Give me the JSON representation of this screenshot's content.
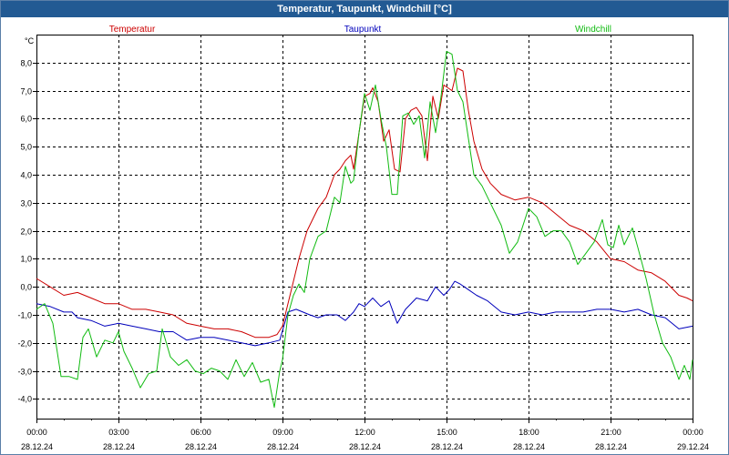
{
  "window": {
    "title": "Temperatur, Taupunkt, Windchill [°C]"
  },
  "colors": {
    "temperatur": "#cc0000",
    "taupunkt": "#0000bb",
    "windchill": "#11bb11",
    "title_bar": "#225a93"
  },
  "chart_data": {
    "type": "line",
    "title": "Temperatur, Taupunkt, Windchill [°C]",
    "ylabel": "°C",
    "xlabel": "",
    "ylim": [
      -4.7,
      9.0
    ],
    "xlim": [
      0,
      24
    ],
    "grid": true,
    "legend_placement": "top",
    "y_ticks": [
      {
        "value": 8,
        "label": "8,0"
      },
      {
        "value": 7,
        "label": "7,0"
      },
      {
        "value": 6,
        "label": "6,0"
      },
      {
        "value": 5,
        "label": "5,0"
      },
      {
        "value": 4,
        "label": "4,0"
      },
      {
        "value": 3,
        "label": "3,0"
      },
      {
        "value": 2,
        "label": "2,0"
      },
      {
        "value": 1,
        "label": "1,0"
      },
      {
        "value": 0,
        "label": "0,0"
      },
      {
        "value": -1,
        "label": "-1,0"
      },
      {
        "value": -2,
        "label": "-2,0"
      },
      {
        "value": -3,
        "label": "-3,0"
      },
      {
        "value": -4,
        "label": "-4,0"
      }
    ],
    "x_ticks": [
      {
        "value": 0,
        "time": "00:00",
        "date": "28.12.24"
      },
      {
        "value": 3,
        "time": "03:00",
        "date": "28.12.24"
      },
      {
        "value": 6,
        "time": "06:00",
        "date": "28.12.24"
      },
      {
        "value": 9,
        "time": "09:00",
        "date": "28.12.24"
      },
      {
        "value": 12,
        "time": "12:00",
        "date": "28.12.24"
      },
      {
        "value": 15,
        "time": "15:00",
        "date": "28.12.24"
      },
      {
        "value": 18,
        "time": "18:00",
        "date": "28.12.24"
      },
      {
        "value": 21,
        "time": "21:00",
        "date": "28.12.24"
      },
      {
        "value": 24,
        "time": "00:00",
        "date": "29.12.24"
      }
    ],
    "series": [
      {
        "name": "Temperatur",
        "points": [
          [
            0,
            0.3
          ],
          [
            0.5,
            0.0
          ],
          [
            1,
            -0.3
          ],
          [
            1.5,
            -0.2
          ],
          [
            2,
            -0.4
          ],
          [
            2.5,
            -0.6
          ],
          [
            3,
            -0.6
          ],
          [
            3.5,
            -0.8
          ],
          [
            4,
            -0.8
          ],
          [
            4.5,
            -0.9
          ],
          [
            5,
            -1.0
          ],
          [
            5.5,
            -1.3
          ],
          [
            6,
            -1.4
          ],
          [
            6.5,
            -1.5
          ],
          [
            7,
            -1.5
          ],
          [
            7.5,
            -1.6
          ],
          [
            8,
            -1.8
          ],
          [
            8.5,
            -1.8
          ],
          [
            8.8,
            -1.7
          ],
          [
            9,
            -1.4
          ],
          [
            9.2,
            -0.6
          ],
          [
            9.4,
            0.2
          ],
          [
            9.6,
            1.0
          ],
          [
            9.9,
            2.0
          ],
          [
            10.3,
            2.8
          ],
          [
            10.6,
            3.2
          ],
          [
            10.9,
            4.0
          ],
          [
            11.1,
            4.2
          ],
          [
            11.3,
            4.5
          ],
          [
            11.5,
            4.7
          ],
          [
            11.6,
            4.2
          ],
          [
            11.8,
            5.5
          ],
          [
            12,
            6.8
          ],
          [
            12.2,
            6.9
          ],
          [
            12.3,
            7.1
          ],
          [
            12.5,
            6.6
          ],
          [
            12.7,
            5.2
          ],
          [
            12.9,
            5.6
          ],
          [
            13.1,
            4.2
          ],
          [
            13.3,
            4.1
          ],
          [
            13.5,
            6.0
          ],
          [
            13.7,
            6.3
          ],
          [
            13.9,
            6.4
          ],
          [
            14.1,
            6.1
          ],
          [
            14.3,
            4.5
          ],
          [
            14.5,
            6.8
          ],
          [
            14.7,
            6.0
          ],
          [
            14.9,
            7.2
          ],
          [
            15.2,
            7.0
          ],
          [
            15.4,
            7.8
          ],
          [
            15.6,
            7.7
          ],
          [
            15.8,
            6.3
          ],
          [
            16,
            5.2
          ],
          [
            16.3,
            4.2
          ],
          [
            16.6,
            3.7
          ],
          [
            17,
            3.3
          ],
          [
            17.5,
            3.1
          ],
          [
            18,
            3.2
          ],
          [
            18.5,
            3.0
          ],
          [
            19,
            2.6
          ],
          [
            19.5,
            2.2
          ],
          [
            20,
            2.0
          ],
          [
            20.5,
            1.6
          ],
          [
            21,
            1.0
          ],
          [
            21.5,
            0.9
          ],
          [
            22,
            0.6
          ],
          [
            22.5,
            0.5
          ],
          [
            23,
            0.2
          ],
          [
            23.5,
            -0.3
          ],
          [
            23.8,
            -0.4
          ],
          [
            24,
            -0.5
          ]
        ]
      },
      {
        "name": "Taupunkt",
        "points": [
          [
            0,
            -0.6
          ],
          [
            0.5,
            -0.7
          ],
          [
            1,
            -0.9
          ],
          [
            1.3,
            -0.9
          ],
          [
            1.5,
            -1.1
          ],
          [
            2,
            -1.2
          ],
          [
            2.5,
            -1.4
          ],
          [
            3,
            -1.3
          ],
          [
            3.5,
            -1.4
          ],
          [
            4,
            -1.5
          ],
          [
            4.5,
            -1.6
          ],
          [
            5,
            -1.6
          ],
          [
            5.5,
            -1.9
          ],
          [
            6,
            -1.8
          ],
          [
            6.5,
            -1.8
          ],
          [
            7,
            -1.9
          ],
          [
            7.5,
            -2.0
          ],
          [
            8,
            -2.1
          ],
          [
            8.5,
            -2.0
          ],
          [
            8.9,
            -1.9
          ],
          [
            9.2,
            -0.9
          ],
          [
            9.5,
            -0.8
          ],
          [
            10,
            -1.0
          ],
          [
            10.3,
            -1.1
          ],
          [
            10.6,
            -1.0
          ],
          [
            11,
            -1.0
          ],
          [
            11.3,
            -1.2
          ],
          [
            11.6,
            -0.9
          ],
          [
            11.8,
            -0.6
          ],
          [
            12,
            -0.7
          ],
          [
            12.3,
            -0.4
          ],
          [
            12.6,
            -0.7
          ],
          [
            12.9,
            -0.5
          ],
          [
            13.2,
            -1.3
          ],
          [
            13.5,
            -0.8
          ],
          [
            13.9,
            -0.4
          ],
          [
            14.3,
            -0.5
          ],
          [
            14.6,
            0.0
          ],
          [
            14.9,
            -0.3
          ],
          [
            15.1,
            -0.1
          ],
          [
            15.3,
            0.2
          ],
          [
            15.5,
            0.1
          ],
          [
            15.8,
            -0.1
          ],
          [
            16.1,
            -0.3
          ],
          [
            16.5,
            -0.5
          ],
          [
            17,
            -0.9
          ],
          [
            17.5,
            -1.0
          ],
          [
            18,
            -0.9
          ],
          [
            18.5,
            -1.0
          ],
          [
            19,
            -0.9
          ],
          [
            19.5,
            -0.9
          ],
          [
            20,
            -0.9
          ],
          [
            20.5,
            -0.8
          ],
          [
            21,
            -0.8
          ],
          [
            21.5,
            -0.9
          ],
          [
            22,
            -0.8
          ],
          [
            22.5,
            -1.0
          ],
          [
            23,
            -1.1
          ],
          [
            23.5,
            -1.5
          ],
          [
            24,
            -1.4
          ]
        ]
      },
      {
        "name": "Windchill",
        "points": [
          [
            0,
            -0.8
          ],
          [
            0.3,
            -0.6
          ],
          [
            0.6,
            -1.3
          ],
          [
            0.9,
            -3.2
          ],
          [
            1.2,
            -3.2
          ],
          [
            1.5,
            -3.3
          ],
          [
            1.7,
            -1.8
          ],
          [
            1.9,
            -1.5
          ],
          [
            2.2,
            -2.5
          ],
          [
            2.5,
            -1.9
          ],
          [
            2.8,
            -2.0
          ],
          [
            3,
            -1.6
          ],
          [
            3.2,
            -2.3
          ],
          [
            3.5,
            -2.9
          ],
          [
            3.8,
            -3.6
          ],
          [
            4.1,
            -3.1
          ],
          [
            4.4,
            -3.0
          ],
          [
            4.6,
            -1.5
          ],
          [
            4.9,
            -2.5
          ],
          [
            5.2,
            -2.8
          ],
          [
            5.5,
            -2.6
          ],
          [
            5.8,
            -3.0
          ],
          [
            6.1,
            -3.1
          ],
          [
            6.4,
            -2.9
          ],
          [
            6.7,
            -3.0
          ],
          [
            7,
            -3.3
          ],
          [
            7.3,
            -2.6
          ],
          [
            7.6,
            -3.2
          ],
          [
            7.9,
            -2.7
          ],
          [
            8.2,
            -3.4
          ],
          [
            8.5,
            -3.3
          ],
          [
            8.7,
            -4.3
          ],
          [
            8.9,
            -3.0
          ],
          [
            9,
            -2.6
          ],
          [
            9.2,
            -1.0
          ],
          [
            9.4,
            -0.3
          ],
          [
            9.6,
            0.1
          ],
          [
            9.8,
            -0.2
          ],
          [
            10,
            1.0
          ],
          [
            10.3,
            1.8
          ],
          [
            10.6,
            2.0
          ],
          [
            10.9,
            3.2
          ],
          [
            11.1,
            3.0
          ],
          [
            11.3,
            4.3
          ],
          [
            11.5,
            3.7
          ],
          [
            11.6,
            3.8
          ],
          [
            11.8,
            5.5
          ],
          [
            12,
            6.9
          ],
          [
            12.2,
            6.3
          ],
          [
            12.4,
            7.2
          ],
          [
            12.6,
            6.0
          ],
          [
            12.8,
            5.0
          ],
          [
            13,
            3.3
          ],
          [
            13.2,
            3.3
          ],
          [
            13.4,
            6.1
          ],
          [
            13.6,
            6.2
          ],
          [
            13.8,
            5.8
          ],
          [
            14,
            6.1
          ],
          [
            14.2,
            4.6
          ],
          [
            14.4,
            6.6
          ],
          [
            14.6,
            5.5
          ],
          [
            14.8,
            6.8
          ],
          [
            15,
            8.4
          ],
          [
            15.2,
            8.3
          ],
          [
            15.4,
            7.0
          ],
          [
            15.6,
            6.6
          ],
          [
            15.8,
            5.3
          ],
          [
            16,
            4.0
          ],
          [
            16.3,
            3.6
          ],
          [
            16.6,
            3.0
          ],
          [
            17,
            2.2
          ],
          [
            17.3,
            1.2
          ],
          [
            17.6,
            1.6
          ],
          [
            18,
            2.8
          ],
          [
            18.3,
            2.5
          ],
          [
            18.6,
            1.8
          ],
          [
            18.9,
            2.0
          ],
          [
            19.2,
            2.0
          ],
          [
            19.5,
            1.6
          ],
          [
            19.8,
            0.8
          ],
          [
            20.1,
            1.2
          ],
          [
            20.4,
            1.6
          ],
          [
            20.7,
            2.4
          ],
          [
            20.9,
            1.5
          ],
          [
            21.1,
            1.4
          ],
          [
            21.3,
            2.2
          ],
          [
            21.5,
            1.5
          ],
          [
            21.8,
            2.1
          ],
          [
            22,
            1.4
          ],
          [
            22.3,
            0.3
          ],
          [
            22.6,
            -1.0
          ],
          [
            22.9,
            -2.0
          ],
          [
            23.2,
            -2.5
          ],
          [
            23.5,
            -3.3
          ],
          [
            23.7,
            -2.8
          ],
          [
            23.9,
            -3.3
          ],
          [
            24,
            -2.6
          ]
        ]
      }
    ]
  }
}
